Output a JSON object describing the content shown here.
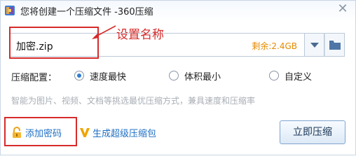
{
  "window": {
    "title": "您将创建一个压缩文件 -360压缩",
    "close_glyph": "✕"
  },
  "filename": {
    "value": "加密.zip",
    "remaining": "剩余:2.4GB"
  },
  "annotation": {
    "label": "设置名称",
    "color": "#d62b2b"
  },
  "compression": {
    "label": "压缩配置：",
    "options": [
      {
        "label": "速度最快",
        "checked": true
      },
      {
        "label": "体积最小",
        "checked": false
      },
      {
        "label": "自定义",
        "checked": false
      }
    ],
    "description": "智能为图片、视频、文档等挑选最优压缩方式，兼具速度和压缩率"
  },
  "links": {
    "password": "添加密码",
    "super": "生成超级压缩包"
  },
  "actions": {
    "compress": "立即压缩"
  },
  "colors": {
    "accent": "#2f7fd1",
    "link": "#1f6fc4",
    "remaining": "#e48a00"
  },
  "icons": {
    "app": "archive-app-icon",
    "close": "close-icon",
    "dropdown": "chevron-down-icon",
    "folder": "folder-icon",
    "lock": "lock-icon",
    "super": "v-check-icon"
  }
}
